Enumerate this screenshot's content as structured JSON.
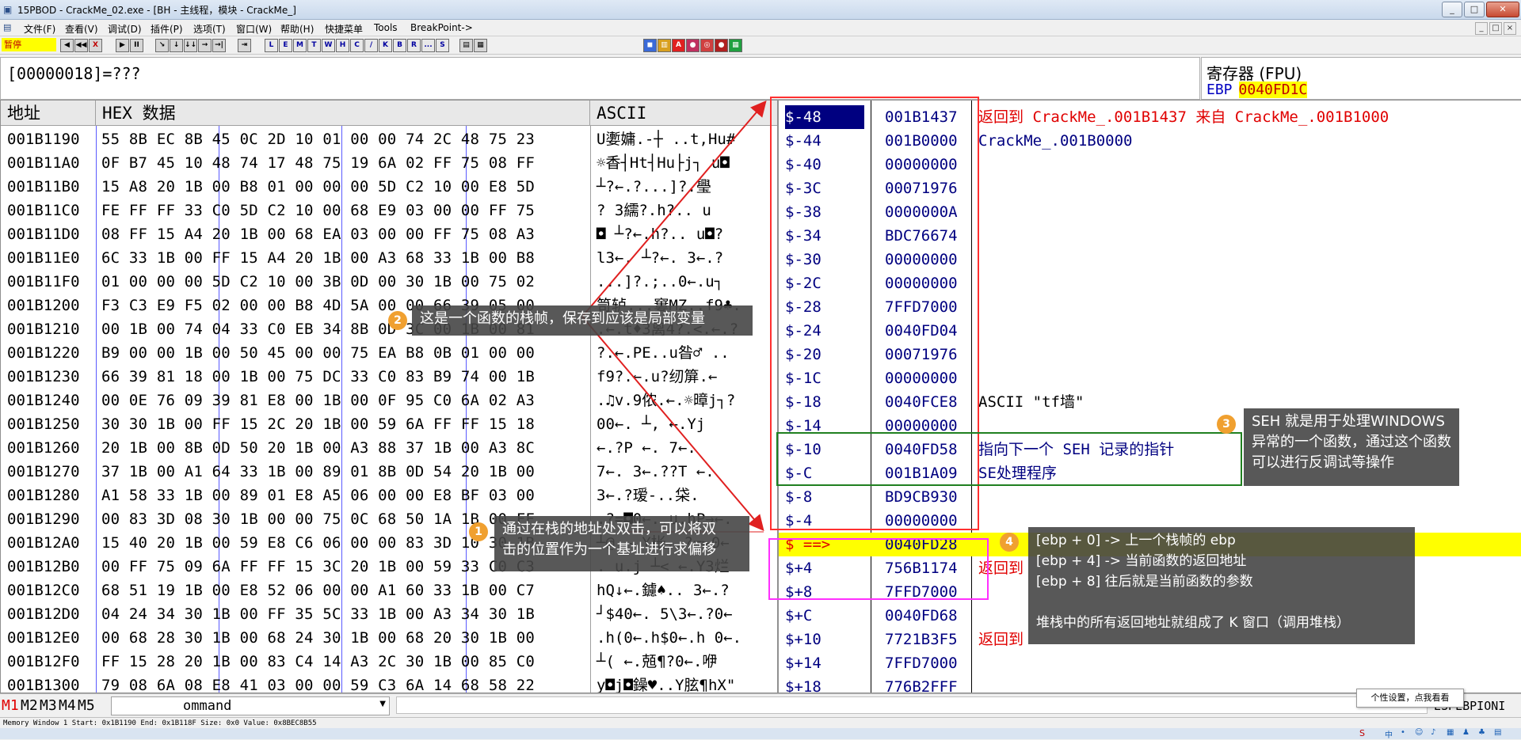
{
  "window": {
    "title": "15PBOD  - CrackMe_02.exe - [BH - 主线程，模块 - CrackMe_]",
    "icon": "app-icon",
    "controls": [
      "_",
      "□",
      "✕"
    ],
    "mdi_controls": [
      "_",
      "□",
      "×"
    ]
  },
  "menu": [
    "文件(F)",
    "查看(V)",
    "调试(D)",
    "插件(P)",
    "选项(T)",
    "窗口(W)",
    "帮助(H)",
    "快捷菜单",
    "Tools",
    "BreakPoint->"
  ],
  "toolbar": {
    "status": "暂停",
    "controls": [
      "◀",
      "◀◀",
      "X",
      "▶",
      "II",
      "↘",
      "↓",
      "↓↓",
      "→",
      "→|",
      "⇥"
    ],
    "letters": [
      "L",
      "E",
      "M",
      "T",
      "W",
      "H",
      "C",
      "/",
      "K",
      "B",
      "R",
      "...",
      "S"
    ],
    "right_icons": [
      "▤",
      "▦",
      "◼",
      "▥",
      "A",
      "●",
      "◎",
      "●",
      "▦"
    ]
  },
  "expression": "[00000018]=???",
  "registers": {
    "title": "寄存器 (FPU)",
    "row_name": "EBP",
    "row_value": "0040FD1C"
  },
  "dump": {
    "headers": {
      "address": "地址",
      "hex": "HEX 数据",
      "ascii": "ASCII"
    },
    "rows": [
      {
        "addr": "001B1190",
        "hex": "55 8B EC 8B 45 0C 2D 10 01 00 00 74 2C 48 75 23",
        "ascii": "U嬱嫞.-┼  ..t,Hu#"
      },
      {
        "addr": "001B11A0",
        "hex": "0F B7 45 10 48 74 17 48 75 19 6A 02 FF 75 08 FF",
        "ascii": "☼香┤Ht┤Hu├j┐  u◘"
      },
      {
        "addr": "001B11B0",
        "hex": "15 A8 20 1B 00 B8 01 00 00 00 5D C2 10 00 E8 5D",
        "ascii": "┴?←.?...]?.璺"
      },
      {
        "addr": "001B11C0",
        "hex": "FE FF FF 33 C0 5D C2 10 00 68 E9 03 00 00 FF 75",
        "ascii": "?  3繻?.h?..  u"
      },
      {
        "addr": "001B11D0",
        "hex": "08 FF 15 A4 20 1B 00 68 EA 03 00 00 FF 75 08 A3",
        "ascii": "◘  ┴?←.h?..  u◘?"
      },
      {
        "addr": "001B11E0",
        "hex": "6C 33 1B 00 FF 15 A4 20 1B 00 A3 68 33 1B 00 B8",
        "ascii": "l3←.  ┴?←.  3←.?"
      },
      {
        "addr": "001B11F0",
        "hex": "01 00 00 00 5D C2 10 00 3B 0D 00 30 1B 00 75 02",
        "ascii": "...]?.;..0←.u┐"
      },
      {
        "addr": "001B1200",
        "hex": "F3 C3 E9 F5 02 00 00 B8 4D 5A 00 00 66 39 05 00",
        "ascii": "笥轳...窶MZ..f9♣."
      },
      {
        "addr": "001B1210",
        "hex": "00 1B 00 74 04 33 C0 EB 34 8B 0D 3C 00 1B 00 81",
        "ascii": ".←.t♦3离4?.<.←.?"
      },
      {
        "addr": "001B1220",
        "hex": "B9 00 00 1B 00 50 45 00 00 75 EA B8 0B 01 00 00",
        "ascii": "?.←.PE..u昝♂  .."
      },
      {
        "addr": "001B1230",
        "hex": "66 39 81 18 00 1B 00 75 DC 33 C0 83 B9 74 00 1B",
        "ascii": "f9?.←.u?纫箳.←"
      },
      {
        "addr": "001B1240",
        "hex": "00 0E 76 09 39 81 E8 00 1B 00 0F 95 C0 6A 02 A3",
        "ascii": ".♫v.9侬.←.☼暲j┐?"
      },
      {
        "addr": "001B1250",
        "hex": "30 30 1B 00 FF 15 2C 20 1B 00 59 6A FF FF 15 18",
        "ascii": "00←.  ┴, ←.Yj"
      },
      {
        "addr": "001B1260",
        "hex": "20 1B 00 8B 0D 50 20 1B 00 A3 88 37 1B 00 A3 8C",
        "ascii": " ←.?P ←.  7←.  "
      },
      {
        "addr": "001B1270",
        "hex": "37 1B 00 A1 64 33 1B 00 89 01 8B 0D 54 20 1B 00",
        "ascii": "7←.  3←.??T ←."
      },
      {
        "addr": "001B1280",
        "hex": "A1 58 33 1B 00 89 01 E8 A5 06 00 00 E8 BF 03 00",
        "ascii": " 3←.?瑷-..柋."
      },
      {
        "addr": "001B1290",
        "hex": "00 83 3D 08 30 1B 00 00 75 0C 68 50 1A 1B 00 FF",
        "ascii": ".?=◘0←..u.hP→←. "
      },
      {
        "addr": "001B12A0",
        "hex": "15 40 20 1B 00 59 E8 C6 06 00 00 83 3D 10 30 1B",
        "ascii": "┴@ ←.Y枨..?=►0←"
      },
      {
        "addr": "001B12B0",
        "hex": "00 FF 75 09 6A FF FF 15 3C 20 1B 00 59 33 C0 C3",
        "ascii": ". u.j  ┴< ←.Y3烂"
      },
      {
        "addr": "001B12C0",
        "hex": "68 51 19 1B 00 E8 52 06 00 00 A1 60 33 1B 00 C7",
        "ascii": "hQ↓←.鑢♠..  3←.?"
      },
      {
        "addr": "001B12D0",
        "hex": "04 24 34 30 1B 00 FF 35 5C 33 1B 00 A3 34 30 1B",
        "ascii": "┘$40←.  5\\3←.?0←"
      },
      {
        "addr": "001B12E0",
        "hex": "00 68 28 30 1B 00 68 24 30 1B 00 68 20 30 1B 00",
        "ascii": ".h(0←.h$0←.h 0←."
      },
      {
        "addr": "001B12F0",
        "hex": "FF 15 28 20 1B 00 83 C4 14 A3 2C 30 1B 00 85 C0",
        "ascii": " ┴( ←.兡¶?0←.咿"
      },
      {
        "addr": "001B1300",
        "hex": "79 08 6A 08 E8 41 03 00 00 59 C3 6A 14 68 58 22",
        "ascii": "y◘j◘鐰♥..Y胘¶hX\""
      }
    ]
  },
  "stack": {
    "rows": [
      {
        "off": "$-48",
        "val": "001B1437",
        "cmt": "返回到 CrackMe_.001B1437 来自 CrackMe_.001B1000",
        "cmt_color": "#e00000"
      },
      {
        "off": "$-44",
        "val": "001B0000",
        "cmt": "CrackMe_.001B0000",
        "cmt_color": "#000080"
      },
      {
        "off": "$-40",
        "val": "00000000",
        "cmt": "",
        "cmt_color": "#000"
      },
      {
        "off": "$-3C",
        "val": "00071976",
        "cmt": "",
        "cmt_color": "#000"
      },
      {
        "off": "$-38",
        "val": "0000000A",
        "cmt": "",
        "cmt_color": "#000"
      },
      {
        "off": "$-34",
        "val": "BDC76674",
        "cmt": "",
        "cmt_color": "#000"
      },
      {
        "off": "$-30",
        "val": "00000000",
        "cmt": "",
        "cmt_color": "#000"
      },
      {
        "off": "$-2C",
        "val": "00000000",
        "cmt": "",
        "cmt_color": "#000"
      },
      {
        "off": "$-28",
        "val": "7FFD7000",
        "cmt": "",
        "cmt_color": "#000"
      },
      {
        "off": "$-24",
        "val": "0040FD04",
        "cmt": "",
        "cmt_color": "#000"
      },
      {
        "off": "$-20",
        "val": "00071976",
        "cmt": "",
        "cmt_color": "#000"
      },
      {
        "off": "$-1C",
        "val": "00000000",
        "cmt": "",
        "cmt_color": "#000"
      },
      {
        "off": "$-18",
        "val": "0040FCE8",
        "cmt": "ASCII \"tf墙\"",
        "cmt_color": "#000"
      },
      {
        "off": "$-14",
        "val": "00000000",
        "cmt": "",
        "cmt_color": "#000"
      },
      {
        "off": "$-10",
        "val": "0040FD58",
        "cmt": "指向下一个 SEH 记录的指针",
        "cmt_color": "#000080"
      },
      {
        "off": "$-C",
        "val": "001B1A09",
        "cmt": "SE处理程序",
        "cmt_color": "#000080"
      },
      {
        "off": "$-8",
        "val": "BD9CB930",
        "cmt": "",
        "cmt_color": "#000"
      },
      {
        "off": "$-4",
        "val": "00000000",
        "cmt": "",
        "cmt_color": "#000"
      },
      {
        "off": "$ ==>",
        "val": "0040FD28",
        "cmt": "",
        "cmt_color": "#000"
      },
      {
        "off": "$+4",
        "val": "756B1174",
        "cmt": "返回到",
        "cmt_color": "#e00000"
      },
      {
        "off": "$+8",
        "val": "7FFD7000",
        "cmt": "",
        "cmt_color": "#000"
      },
      {
        "off": "$+C",
        "val": "0040FD68",
        "cmt": "",
        "cmt_color": "#000"
      },
      {
        "off": "$+10",
        "val": "7721B3F5",
        "cmt": "返回到",
        "cmt_color": "#e00000"
      },
      {
        "off": "$+14",
        "val": "7FFD7000",
        "cmt": "",
        "cmt_color": "#000"
      },
      {
        "off": "$+18",
        "val": "776B2FFF",
        "cmt": "",
        "cmt_color": "#000"
      }
    ]
  },
  "annotations": {
    "n1": {
      "badge": "1",
      "lines": [
        "通过在栈的地址处双击，可以将双",
        "击的位置作为一个基址进行求偏移"
      ]
    },
    "n2": {
      "badge": "2",
      "lines": [
        "这是一个函数的栈帧，保存到应该是局部变量"
      ]
    },
    "n3": {
      "badge": "3",
      "lines": [
        "SEH 就是用于处理WINDOWS",
        "异常的一个函数，通过这个函数",
        "可以进行反调试等操作"
      ]
    },
    "n4": {
      "badge": "4",
      "lines": [
        "[ebp + 0] -> 上一个栈帧的 ebp",
        "[ebp + 4] -> 当前函数的返回地址",
        "[ebp + 8] 往后就是当前函数的参数",
        "",
        "堆栈中的所有返回地址就组成了 K 窗口（调用堆栈）"
      ]
    }
  },
  "command_bar": {
    "tabs": [
      "M1",
      "M2",
      "M3",
      "M4",
      "M5"
    ],
    "input_text": "ommand",
    "right_text": "ESPEBPIONI"
  },
  "status_line": "Memory Window 1   Start: 0x1B1190   End: 0x1B118F   Size: 0x0  Value: 0x8BEC8B55",
  "tooltip": "个性设置，点我看看",
  "colors": {
    "stack_red_box": "#ff3030",
    "seh_green_box": "#208020",
    "ebp_magenta_box": "#ff30ff",
    "current_row_highlight": "#ffff00",
    "accent_navy": "#000080"
  }
}
